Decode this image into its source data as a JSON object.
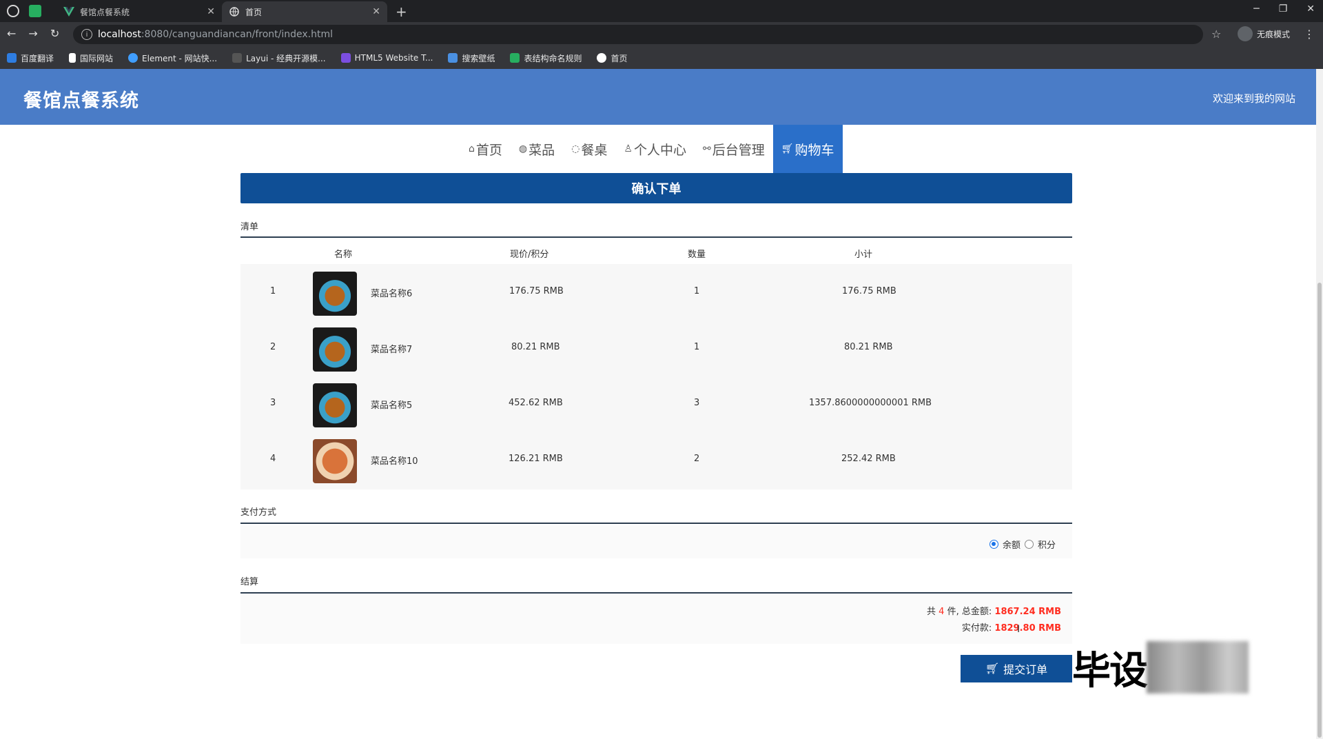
{
  "browser": {
    "tabs": [
      {
        "title": "餐馆点餐系统",
        "icon": "vue-logo-icon"
      },
      {
        "title": "首页",
        "icon": "globe-icon"
      }
    ],
    "url_host": "localhost",
    "url_path": ":8080/canguandiancan/front/index.html",
    "incognito_label": "无痕模式",
    "bookmarks": [
      "百度翻译",
      "国际网站",
      "Element - 网站快...",
      "Layui - 经典开源模...",
      "HTML5 Website T...",
      "搜索壁纸",
      "表结构命名规则",
      "首页"
    ]
  },
  "header": {
    "title": "餐馆点餐系统",
    "welcome": "欢迎来到我的网站"
  },
  "nav": {
    "items": [
      {
        "label": "首页",
        "icon": "home-icon"
      },
      {
        "label": "菜品",
        "icon": "dish-icon"
      },
      {
        "label": "餐桌",
        "icon": "table-icon"
      },
      {
        "label": "个人中心",
        "icon": "user-icon"
      },
      {
        "label": "后台管理",
        "icon": "link-icon"
      },
      {
        "label": "购物车",
        "icon": "cart-icon",
        "active": true
      }
    ]
  },
  "page": {
    "confirm_title": "确认下单",
    "list_label": "清单",
    "columns": [
      "名称",
      "现价/积分",
      "数量",
      "小计"
    ],
    "items": [
      {
        "index": "1",
        "name": "菜品名称6",
        "price": "176.75 RMB",
        "qty": "1",
        "subtotal": "176.75 RMB"
      },
      {
        "index": "2",
        "name": "菜品名称7",
        "price": "80.21 RMB",
        "qty": "1",
        "subtotal": "80.21 RMB"
      },
      {
        "index": "3",
        "name": "菜品名称5",
        "price": "452.62 RMB",
        "qty": "3",
        "subtotal": "1357.8600000000001 RMB"
      },
      {
        "index": "4",
        "name": "菜品名称10",
        "price": "126.21 RMB",
        "qty": "2",
        "subtotal": "252.42 RMB"
      }
    ],
    "payment_label": "支付方式",
    "payment_options": [
      "余额",
      "积分"
    ],
    "payment_selected": "余额",
    "settle_label": "结算",
    "settle": {
      "prefix": "共",
      "count": "4",
      "unit": "件,",
      "total_label": "总金额:",
      "total": "1867.24 RMB",
      "paid_label": "实付款:",
      "paid": "1829.80 RMB"
    },
    "submit_label": "提交订单"
  },
  "watermark": "毕设"
}
